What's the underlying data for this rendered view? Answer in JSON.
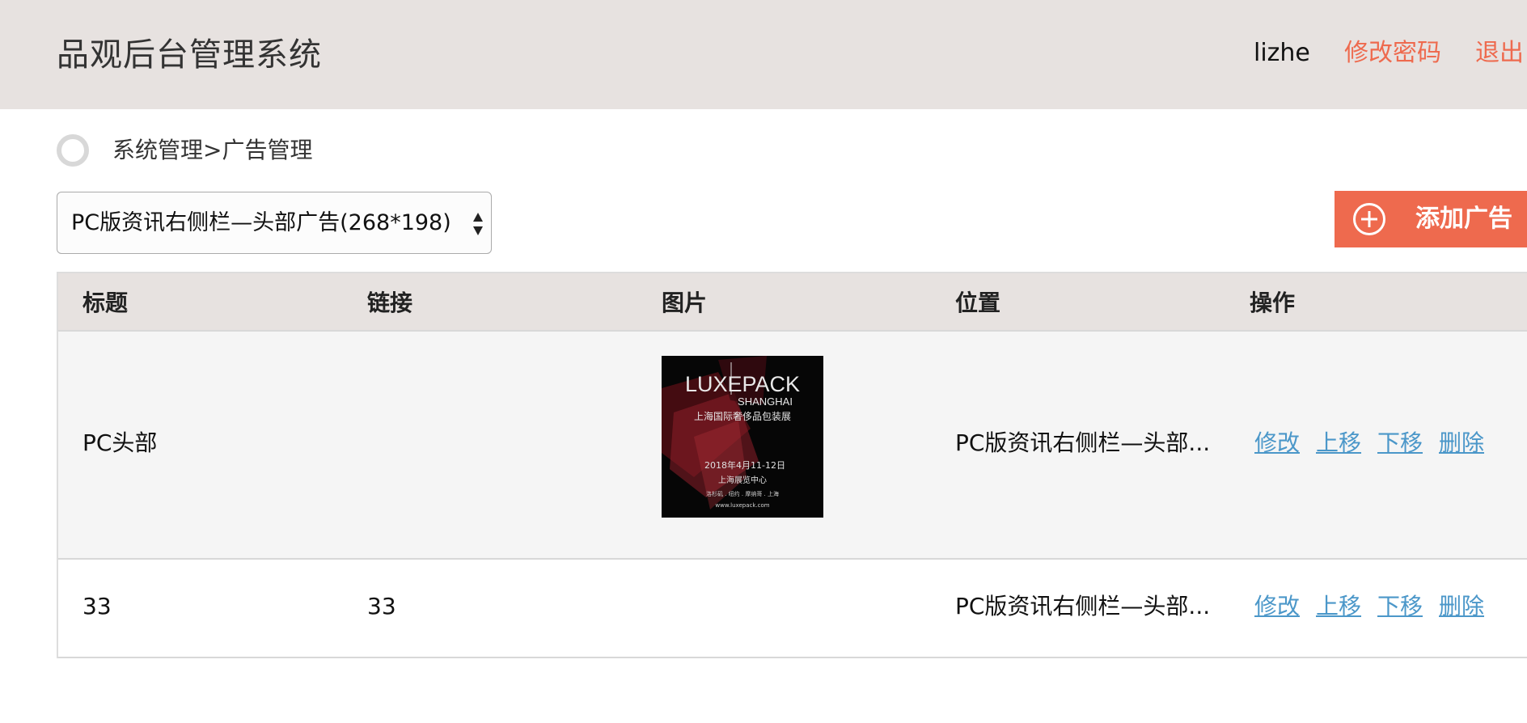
{
  "header": {
    "title": "品观后台管理系统",
    "user": "lizhe",
    "change_password": "修改密码",
    "logout": "退出"
  },
  "breadcrumb": "系统管理>广告管理",
  "filter": {
    "selected": "PC版资讯右侧栏—头部广告(268*198)"
  },
  "add_button": {
    "label": "添加广告",
    "icon": "plus-circle-icon"
  },
  "table": {
    "columns": [
      "标题",
      "链接",
      "图片",
      "位置",
      "操作"
    ],
    "rows": [
      {
        "title": "PC头部",
        "link": "",
        "image": {
          "brand": "LUXEPACK",
          "city": "SHANGHAI",
          "subtitle": "上海国际奢侈品包装展",
          "date": "2018年4月11-12日",
          "venue": "上海展览中心",
          "cities": "洛杉矶 . 纽约 . 摩纳哥 . 上海",
          "url": "www.luxepack.com"
        },
        "position": "PC版资讯右侧栏—头部...",
        "actions": [
          "修改",
          "上移",
          "下移",
          "删除"
        ]
      },
      {
        "title": "33",
        "link": "33",
        "position": "PC版资讯右侧栏—头部...",
        "actions": [
          "修改",
          "上移",
          "下移",
          "删除"
        ]
      }
    ]
  },
  "colors": {
    "header_bg": "#e7e2e0",
    "accent": "#ee6a4e",
    "link": "#4b97c9",
    "row_alt": "#f5f5f5"
  }
}
